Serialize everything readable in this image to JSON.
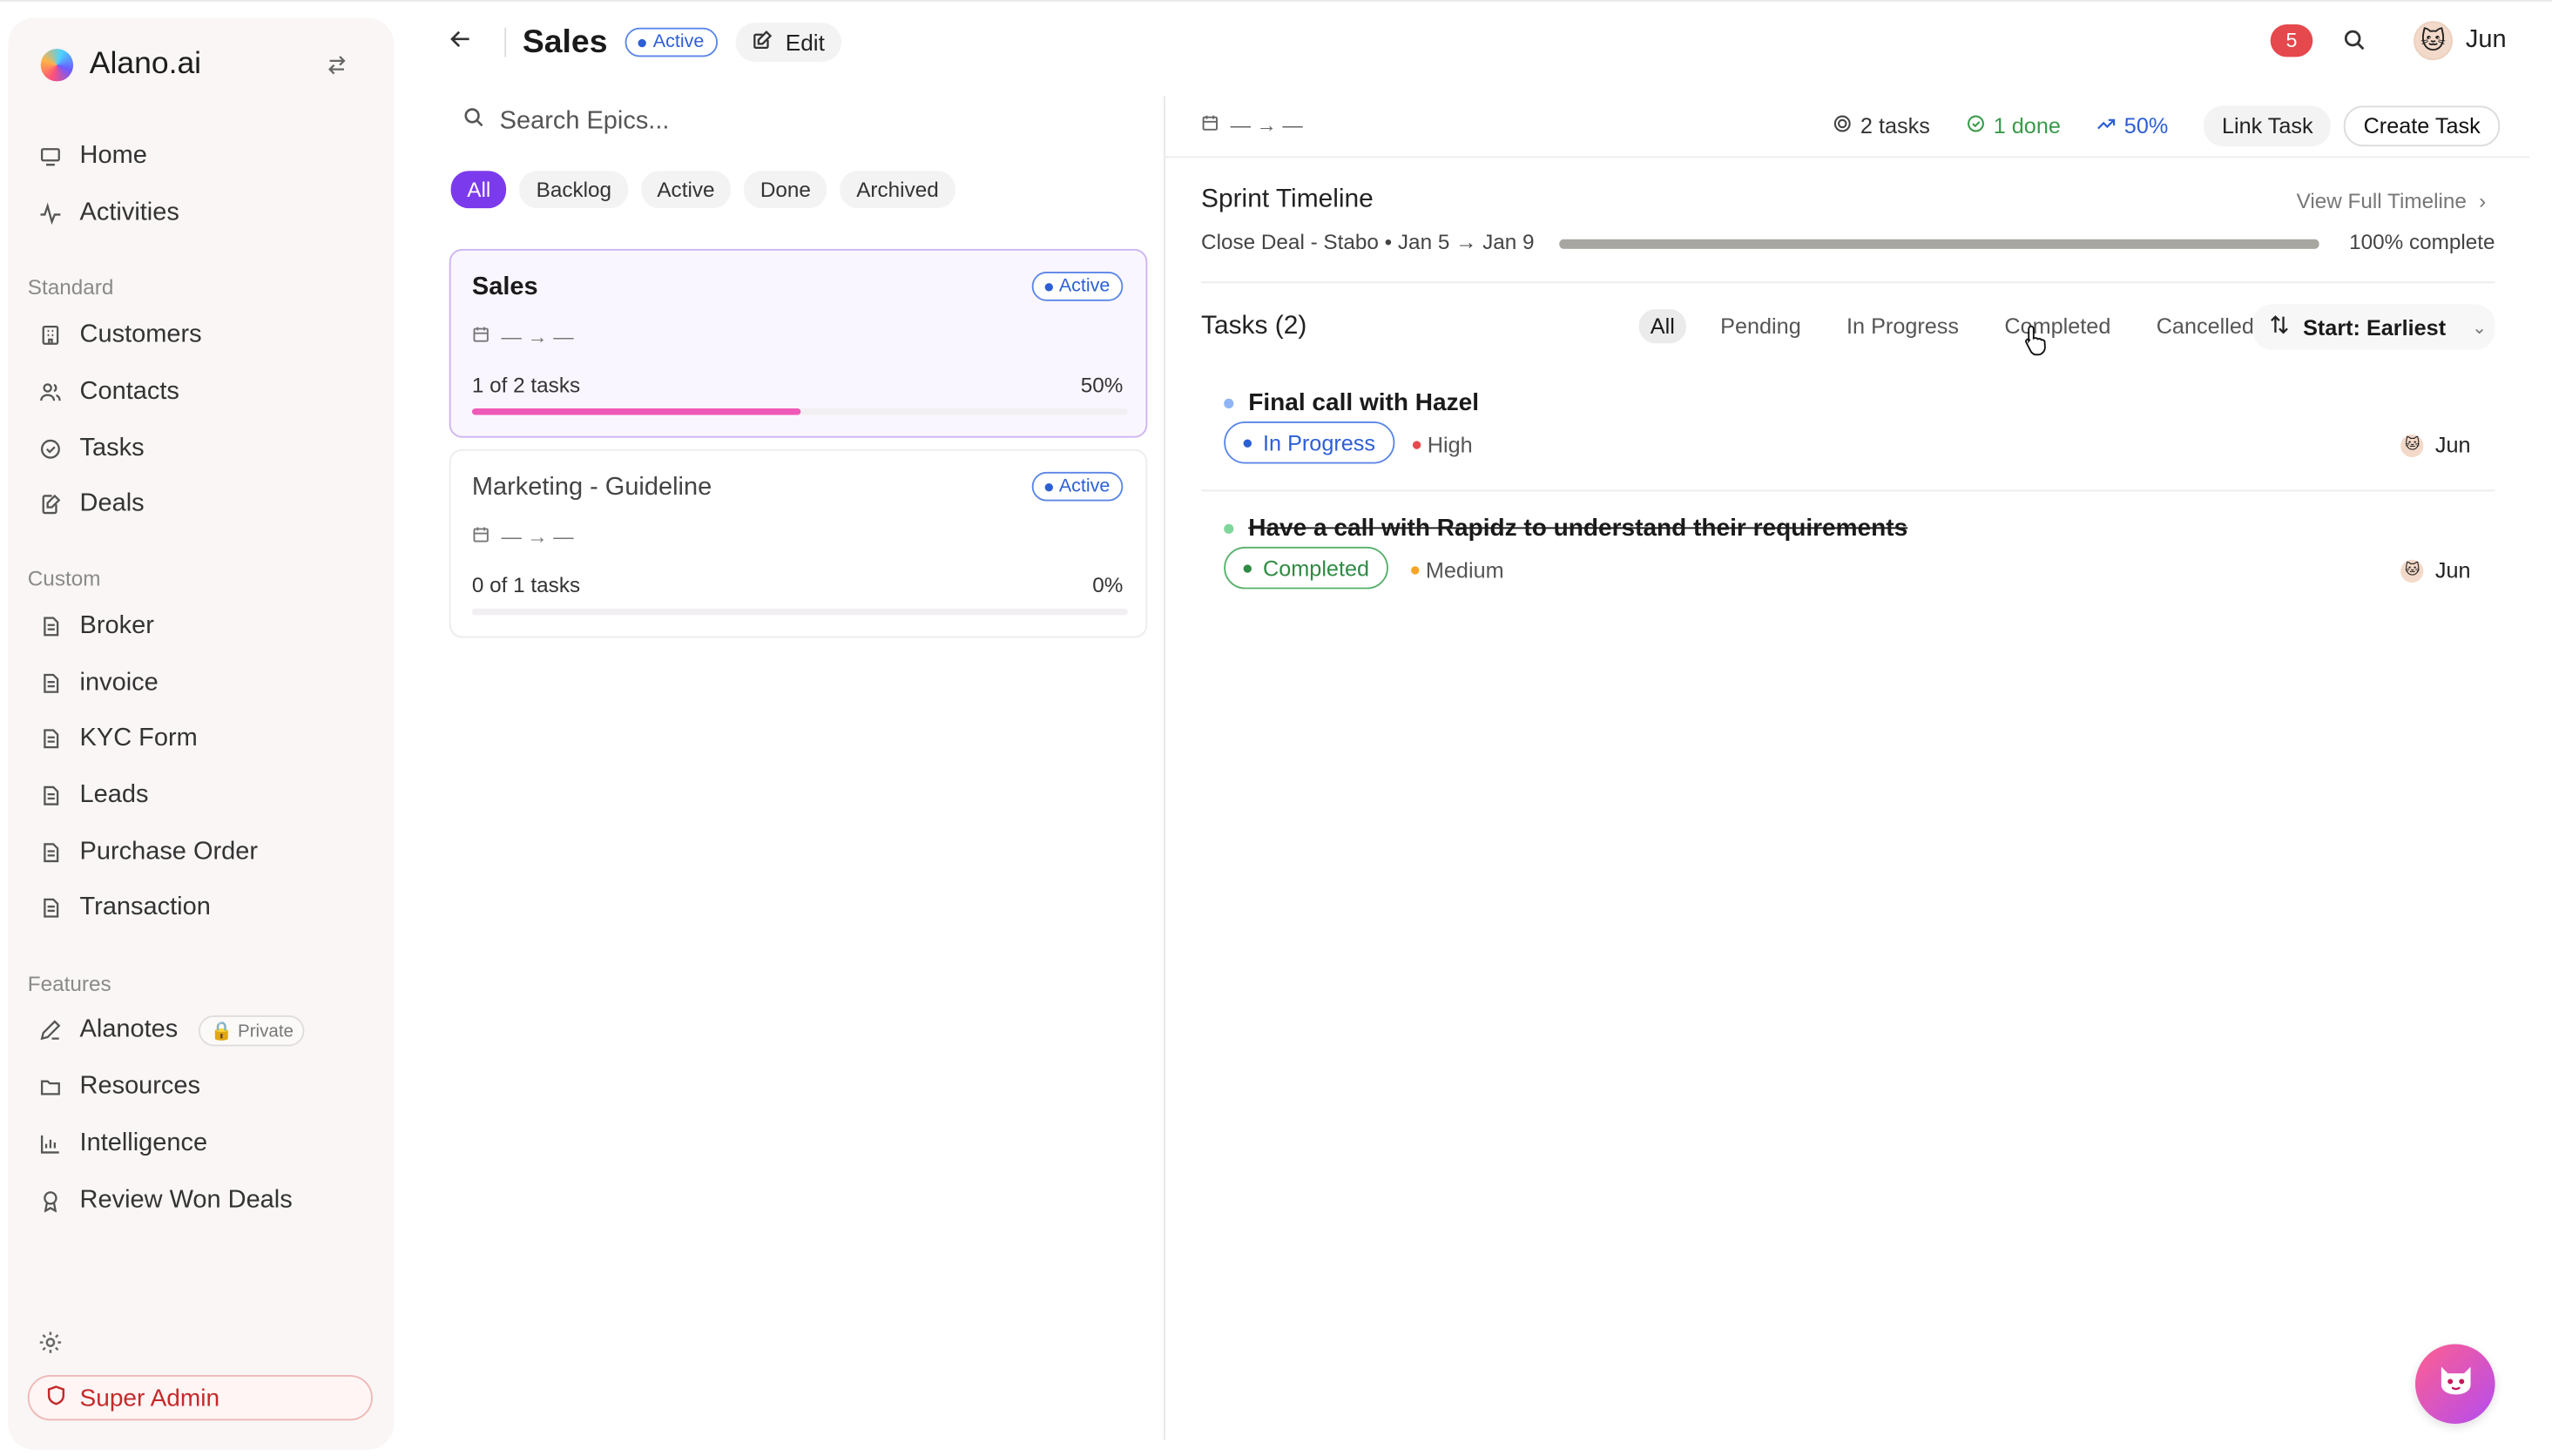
{
  "app": {
    "name": "Alano.ai"
  },
  "sidebar": {
    "top_items": [
      {
        "label": "Home",
        "icon": "monitor-icon"
      },
      {
        "label": "Activities",
        "icon": "activity-icon"
      }
    ],
    "sections": [
      {
        "label": "Standard",
        "items": [
          {
            "label": "Customers",
            "icon": "building-icon"
          },
          {
            "label": "Contacts",
            "icon": "users-icon"
          },
          {
            "label": "Tasks",
            "icon": "check-circle-icon"
          },
          {
            "label": "Deals",
            "icon": "file-edit-icon"
          }
        ]
      },
      {
        "label": "Custom",
        "items": [
          {
            "label": "Broker",
            "icon": "file-icon"
          },
          {
            "label": "invoice",
            "icon": "file-icon"
          },
          {
            "label": "KYC Form",
            "icon": "file-icon"
          },
          {
            "label": "Leads",
            "icon": "file-icon"
          },
          {
            "label": "Purchase Order",
            "icon": "file-icon"
          },
          {
            "label": "Transaction",
            "icon": "file-icon"
          }
        ]
      },
      {
        "label": "Features",
        "items": [
          {
            "label": "Alanotes",
            "icon": "pen-icon",
            "badge": "Private"
          },
          {
            "label": "Resources",
            "icon": "folder-icon"
          },
          {
            "label": "Intelligence",
            "icon": "bar-chart-icon"
          },
          {
            "label": "Review Won Deals",
            "icon": "award-icon"
          }
        ]
      }
    ],
    "super_admin_label": "Super Admin"
  },
  "header": {
    "title": "Sales",
    "status": "Active",
    "edit_label": "Edit",
    "notification_count": "5",
    "user_name": "Jun"
  },
  "epics": {
    "search_placeholder": "Search Epics...",
    "filters": [
      "All",
      "Backlog",
      "Active",
      "Done",
      "Archived"
    ],
    "active_filter": "All",
    "cards": [
      {
        "title": "Sales",
        "status": "Active",
        "dates": "— → —",
        "progress_label": "1 of 2 tasks",
        "progress_pct": "50%",
        "progress": 0.5,
        "selected": true
      },
      {
        "title": "Marketing - Guideline",
        "status": "Active",
        "dates": "— → —",
        "progress_label": "0 of 1 tasks",
        "progress_pct": "0%",
        "progress": 0,
        "selected": false
      }
    ]
  },
  "detail": {
    "dates": "— → —",
    "stats": {
      "tasks": "2 tasks",
      "done": "1 done",
      "pct": "50%"
    },
    "link_task_label": "Link Task",
    "create_task_label": "Create Task",
    "sprint": {
      "title": "Sprint Timeline",
      "view_full_label": "View Full Timeline",
      "label": "Close Deal - Stabo • Jan 5 → Jan 9",
      "progress": 1.0,
      "pct_label": "100% complete"
    },
    "tasks_title": "Tasks (2)",
    "task_filters": [
      "All",
      "Pending",
      "In Progress",
      "Completed",
      "Cancelled"
    ],
    "active_task_filter": "All",
    "sort_label": "Start: Earliest",
    "tasks": [
      {
        "title": "Final call with Hazel",
        "status": "In Progress",
        "priority": "High",
        "assignee": "Jun",
        "done": false
      },
      {
        "title": "Have a call with Rapidz to understand their requirements",
        "status": "Completed",
        "priority": "Medium",
        "assignee": "Jun",
        "done": true
      }
    ]
  },
  "colors": {
    "accent": "#7c3aed",
    "active_blue": "#2c5fd6",
    "completed_green": "#2f8a43",
    "high_priority": "#e5484d",
    "medium_priority": "#f5a524",
    "epic_progress": "#ef59b7",
    "notification": "#e5484d"
  }
}
